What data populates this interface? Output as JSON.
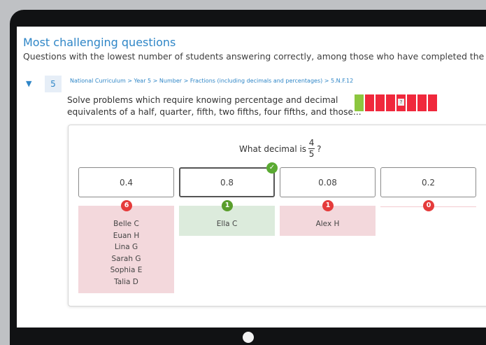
{
  "section": {
    "title": "Most challenging questions",
    "subtitle": "Questions with the lowest number of students answering correctly, among those who have completed the test"
  },
  "question": {
    "number": "5",
    "breadcrumb": "National Curriculum > Year 5 > Number > Fractions (including decimals and percentages) > 5.N.F.12",
    "text": "Solve problems which require knowing percentage and decimal equivalents of a half, quarter, fifth, two fifths, four fifths, and those...",
    "prompt_before": "What decimal is",
    "fraction_numerator": "4",
    "fraction_denominator": "5",
    "prompt_after": "?",
    "result_bars": [
      {
        "status": "correct",
        "color": "#8cc63f",
        "label": ""
      },
      {
        "status": "incorrect",
        "color": "#f0283c",
        "label": ""
      },
      {
        "status": "incorrect",
        "color": "#f0283c",
        "label": ""
      },
      {
        "status": "incorrect",
        "color": "#f0283c",
        "label": ""
      },
      {
        "status": "unanswered",
        "color": "#f0283c",
        "label": "?"
      },
      {
        "status": "incorrect",
        "color": "#f0283c",
        "label": ""
      },
      {
        "status": "incorrect",
        "color": "#f0283c",
        "label": ""
      },
      {
        "status": "incorrect",
        "color": "#f0283c",
        "label": ""
      }
    ]
  },
  "answers": [
    {
      "value": "0.4",
      "correct": false,
      "count": "6",
      "students": [
        "Belle C",
        "Euan H",
        "Lina G",
        "Sarah G",
        "Sophia E",
        "Talia D"
      ]
    },
    {
      "value": "0.8",
      "correct": true,
      "count": "1",
      "students": [
        "Ella C"
      ]
    },
    {
      "value": "0.08",
      "correct": false,
      "count": "1",
      "students": [
        "Alex H"
      ]
    },
    {
      "value": "0.2",
      "correct": false,
      "count": "0",
      "students": []
    }
  ],
  "icons": {
    "expand": "▼",
    "tick": "✓"
  },
  "colors": {
    "accent": "#2f86c7",
    "correct": "#5a9e2c",
    "incorrect": "#e53b3b"
  }
}
